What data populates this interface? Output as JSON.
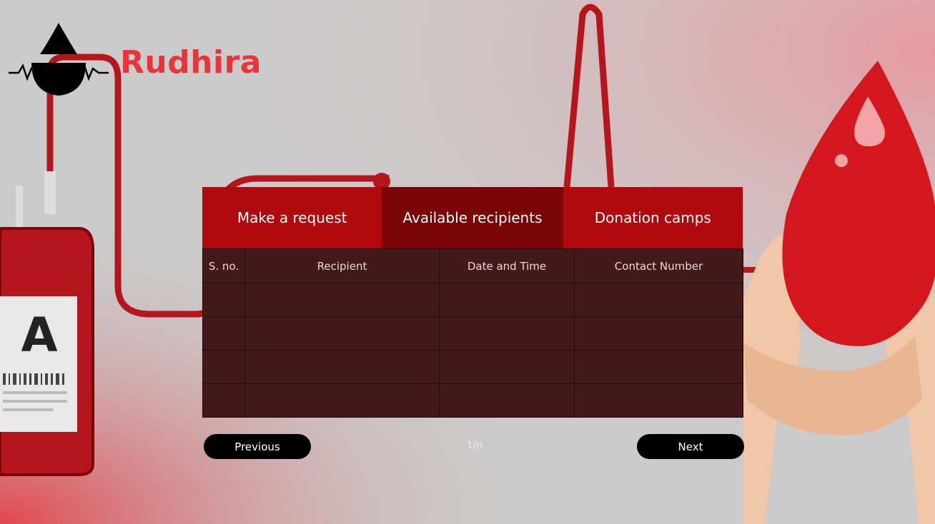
{
  "brand": {
    "name": "Rudhira"
  },
  "background": {
    "bag_label": "A"
  },
  "tabs": [
    {
      "label": "Make a request",
      "active": false
    },
    {
      "label": "Available recipients",
      "active": true
    },
    {
      "label": "Donation camps",
      "active": false
    }
  ],
  "table": {
    "columns": [
      "S. no.",
      "Recipient",
      "Date and Time",
      "Contact Number"
    ],
    "rows": [
      [
        "",
        "",
        "",
        ""
      ],
      [
        "",
        "",
        "",
        ""
      ],
      [
        "",
        "",
        "",
        ""
      ],
      [
        "",
        "",
        "",
        ""
      ]
    ]
  },
  "pagination": {
    "previous_label": "Previous",
    "next_label": "Next",
    "page_indicator": "1/n"
  },
  "colors": {
    "brand": "#e8353c",
    "tab": "#b00a0e",
    "tab_active": "#7a0406",
    "table_bg": "#431a1c"
  }
}
